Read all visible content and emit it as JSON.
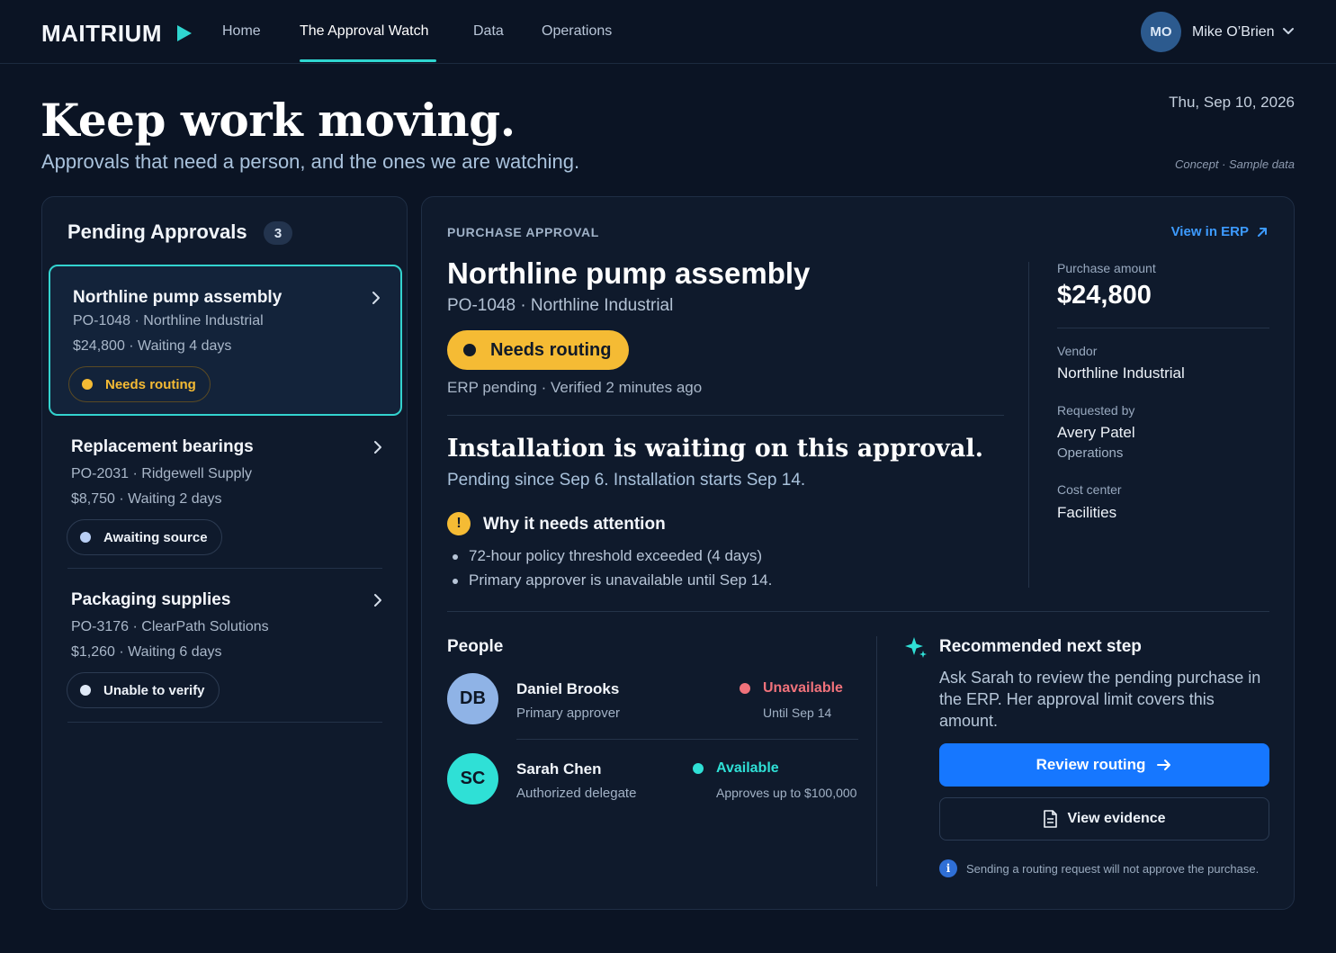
{
  "nav": {
    "logo": "MAITRIUM",
    "links": [
      "Home",
      "The Approval Watch",
      "Data",
      "Operations"
    ],
    "active_index": 1,
    "user": {
      "initials": "MO",
      "name": "Mike O’Brien"
    }
  },
  "hero": {
    "title": "Keep work moving.",
    "subtitle": "Approvals that need a person, and the ones we are watching.",
    "date": "Thu, Sep 10, 2026",
    "note": "Concept · Sample data"
  },
  "queue": {
    "title": "Pending Approvals",
    "count": "3",
    "items": [
      {
        "title": "Northline pump assembly",
        "ref": "PO-1048 · Northline Industrial",
        "meta": "$24,800 · Waiting 4 days",
        "status": "Needs routing",
        "status_color": "#f5bb34",
        "text_color": "#f5bb34"
      },
      {
        "title": "Replacement bearings",
        "ref": "PO-2031 · Ridgewell Supply",
        "meta": "$8,750 · Waiting 2 days",
        "status": "Awaiting source",
        "status_color": "#b9cff5",
        "text_color": "#eef3f9"
      },
      {
        "title": "Packaging supplies",
        "ref": "PO-3176 · ClearPath Solutions",
        "meta": "$1,260 · Waiting 6 days",
        "status": "Unable to verify",
        "status_color": "#dfe9f7",
        "text_color": "#eef3f9"
      }
    ]
  },
  "detail": {
    "eyebrow": "PURCHASE APPROVAL",
    "view_erp": "View in ERP",
    "title": "Northline pump assembly",
    "subtitle": "PO-1048 · Northline Industrial",
    "status": "Needs routing",
    "erp_meta": "ERP pending · Verified 2 minutes ago",
    "waiting_title": "Installation is waiting on this approval.",
    "waiting_sub": "Pending since Sep 6. Installation starts Sep 14.",
    "attention_title": "Why it needs attention",
    "attention_points": [
      "72-hour policy threshold exceeded (4 days)",
      "Primary approver is unavailable until Sep 14."
    ],
    "facts": {
      "amount_label": "Purchase amount",
      "amount": "$24,800",
      "vendor_label": "Vendor",
      "vendor": "Northline Industrial",
      "requested_label": "Requested by",
      "requested_by": "Avery Patel",
      "requested_dept": "Operations",
      "cost_center_label": "Cost center",
      "cost_center": "Facilities"
    },
    "people_title": "People",
    "people": [
      {
        "initials": "DB",
        "name": "Daniel Brooks",
        "role": "Primary approver",
        "status": "Unavailable",
        "status_color": "#f0727b",
        "detail": "Until Sep 14",
        "avatar_color": "#8fb3e6"
      },
      {
        "initials": "SC",
        "name": "Sarah Chen",
        "role": "Authorized delegate",
        "status": "Available",
        "status_color": "#2fe0d6",
        "detail": "Approves up to $100,000",
        "avatar_color": "#2fe0d6"
      }
    ],
    "recommendation": {
      "title": "Recommended next step",
      "body": "Ask Sarah to review the pending purchase in the ERP. Her approval limit covers this amount.",
      "primary": "Review routing",
      "secondary": "View evidence",
      "note": "Sending a routing request will not approve the purchase."
    }
  }
}
